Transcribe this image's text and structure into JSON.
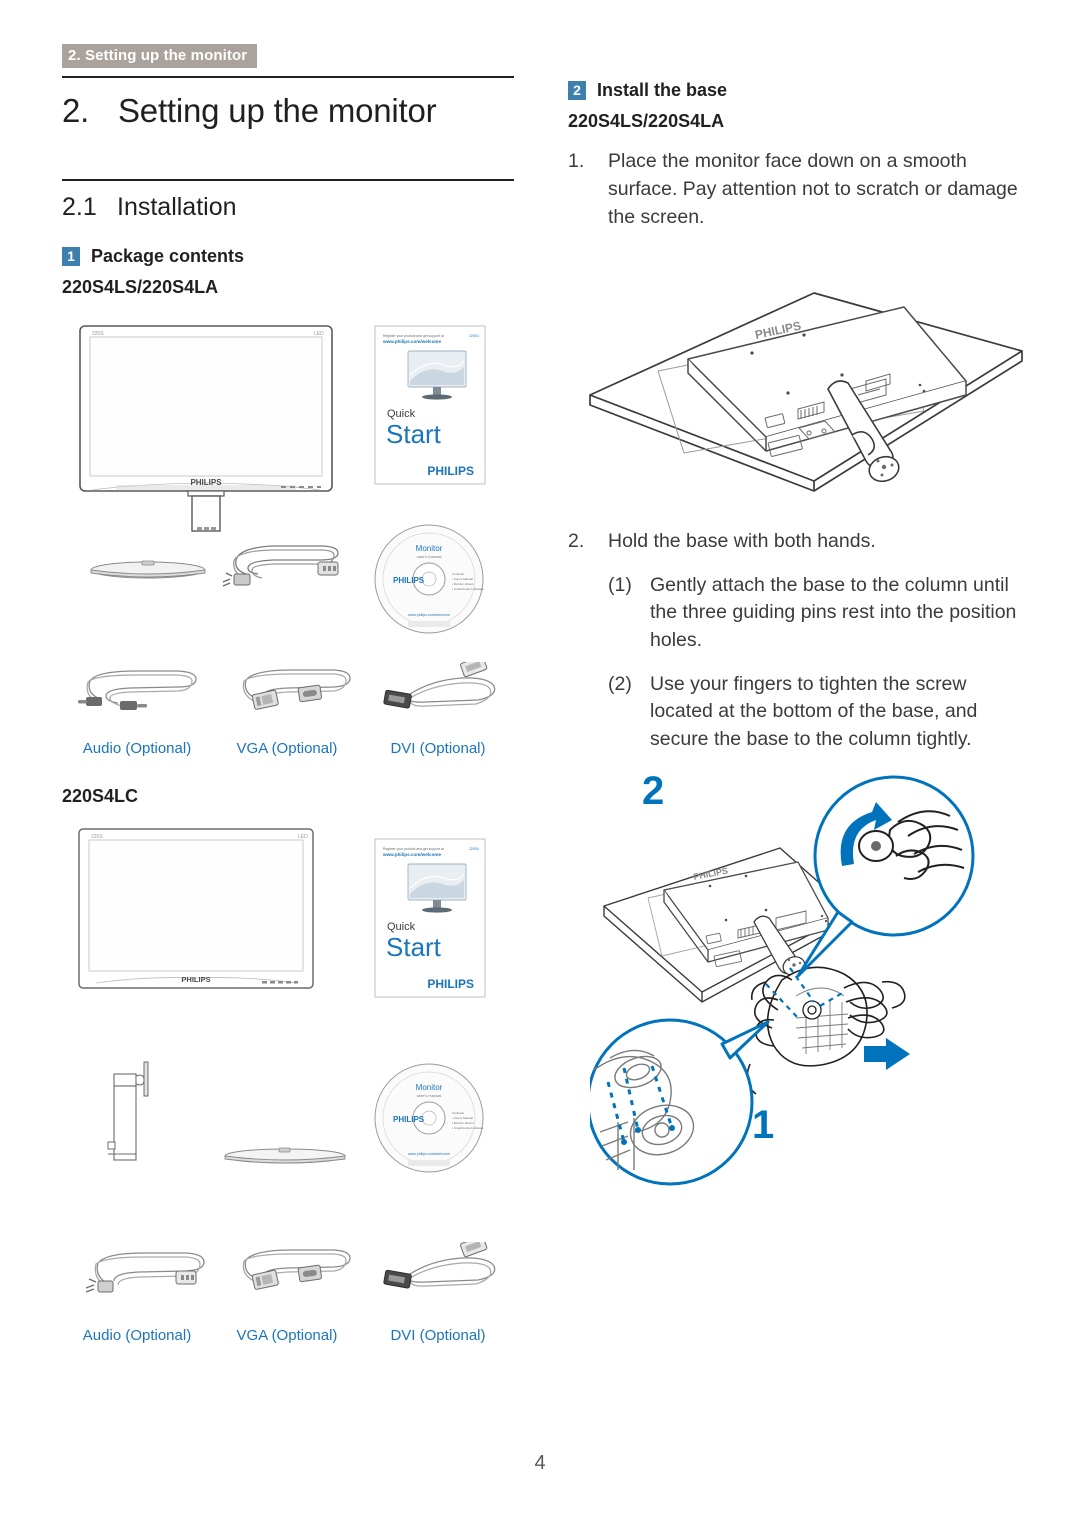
{
  "running_header": "2. Setting up the monitor",
  "chapter": {
    "number": "2.",
    "title": "Setting up the monitor"
  },
  "section": {
    "number": "2.1",
    "title": "Installation"
  },
  "left_column": {
    "step1": {
      "badge": "1",
      "label": "Package contents",
      "model": "220S4LS/220S4LA"
    },
    "step2_model": "220S4LC",
    "cable_captions_a": [
      "Audio (Optional)",
      "VGA (Optional)",
      "DVI (Optional)"
    ],
    "cable_captions_b": [
      "Audio (Optional)",
      "VGA (Optional)",
      "DVI (Optional)"
    ]
  },
  "right_column": {
    "badge": "2",
    "heading": "Install the base",
    "model": "220S4LS/220S4LA",
    "steps": [
      {
        "marker": "1.",
        "text": "Place the monitor face down on a smooth surface. Pay attention not to scratch or damage the screen."
      },
      {
        "marker": "2.",
        "text": "Hold the base with both hands."
      },
      {
        "marker": "(1)",
        "text": "Gently attach the base to the column until the three guiding pins rest into the position holes."
      },
      {
        "marker": "(2)",
        "text": "Use your fingers to tighten the screw located at the bottom of the base, and secure the base to the column tightly."
      }
    ],
    "callouts": [
      "2",
      "1"
    ]
  },
  "artwork_text": {
    "quick_start_quick": "Quick",
    "quick_start_start": "Start",
    "brand": "PHILIPS",
    "cd_title": "Monitor",
    "cd_subtitle": "user's manual"
  },
  "page_number": "4",
  "colors": {
    "header_band": "#aaa29c",
    "badge_blue": "#3d7fad",
    "caption_blue": "#1b75bb",
    "callout_blue": "#0073bc",
    "text": "#231f20",
    "body_text": "#3b3b3b"
  }
}
